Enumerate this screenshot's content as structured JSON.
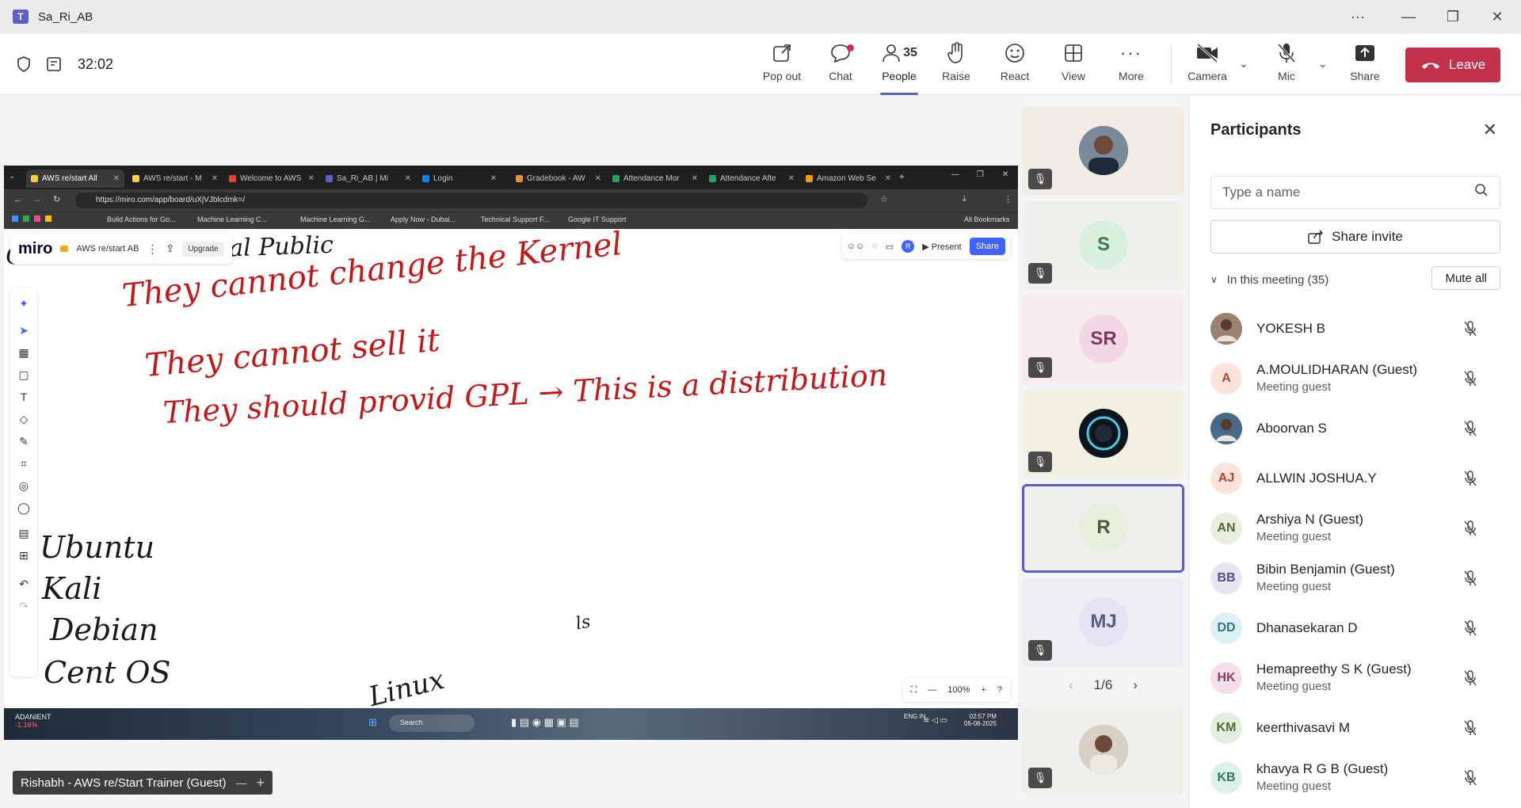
{
  "window": {
    "title": "Sa_Ri_AB",
    "controls": [
      "···",
      "—",
      "❐",
      "✕"
    ]
  },
  "toolbar": {
    "timer": "32:02",
    "buttons": [
      {
        "label": "Pop out",
        "icon": "pop-out-icon"
      },
      {
        "label": "Chat",
        "icon": "chat-icon"
      },
      {
        "label": "People",
        "icon": "people-icon",
        "count": "35"
      },
      {
        "label": "Raise",
        "icon": "raise-hand-icon"
      },
      {
        "label": "React",
        "icon": "react-icon"
      },
      {
        "label": "View",
        "icon": "view-icon"
      },
      {
        "label": "More",
        "icon": "more-icon"
      },
      {
        "label": "Camera",
        "icon": "camera-off-icon"
      },
      {
        "label": "Mic",
        "icon": "mic-off-icon"
      },
      {
        "label": "Share",
        "icon": "share-icon"
      }
    ],
    "leave_label": "Leave",
    "leave_color": "#c4314b",
    "accent": "#5b5fc7"
  },
  "shared_screen": {
    "tabs": [
      "AWS re/start All",
      "AWS re/start - M",
      "Welcome to AWS",
      "Sa_Ri_AB | Mi",
      "Login",
      "Gradebook - AW",
      "Attendance Mor",
      "Attendance Afte",
      "Amazon Web Se"
    ],
    "url": "https://miro.com/app/board/uXjVJblcdmk=/",
    "bookmarks": [
      "Build Actions for Go...",
      "Machine Learning C...",
      "Machine Learning G...",
      "Apply Now - Dubai...",
      "Technical Support F...",
      "Google IT Support",
      "All Bookmarks"
    ],
    "miro": {
      "logo": "miro",
      "board_name": "AWS re/start AB",
      "upgrade": "Upgrade",
      "present": "Present",
      "share": "Share",
      "avatar_initial": "R",
      "zoom": "100%"
    },
    "handwriting": {
      "top_partial": "Os   not   Unix        General    Public",
      "line1": "They  cannot  change  the  Kernel",
      "line2": "They  cannot   sell   it",
      "line3": "They  should   provid   GPL → This  is  a  distribution",
      "list": [
        "Ubuntu",
        "Kali",
        "Debian",
        "Cent OS"
      ],
      "bottom_partial": "Linux",
      "scribble": "ls"
    },
    "taskbar": {
      "stock": "ADANIENT",
      "stock_change": "-1.16%",
      "search": "Search",
      "lang": "ENG\nIN",
      "time": "02:57 PM",
      "date": "06-08-2025"
    }
  },
  "presenter_label": "Rishabh - AWS re/Start Trainer (Guest)",
  "video_tiles": [
    {
      "initials": "",
      "avatar": "photo",
      "color": "#3a4a5a"
    },
    {
      "initials": "S",
      "color": "#d9f0dc"
    },
    {
      "initials": "SR",
      "color": "#f3d9e6"
    },
    {
      "initials": "",
      "avatar": "logo",
      "color": "#101820"
    },
    {
      "initials": "R",
      "color": "#e6efdc"
    },
    {
      "initials": "MJ",
      "color": "#e6e3f3"
    },
    {
      "initials": "",
      "avatar": "photo",
      "color": "#8a7a6a"
    }
  ],
  "pager": "1/6",
  "participants_panel": {
    "title": "Participants",
    "search_placeholder": "Type a name",
    "share_invite": "Share invite",
    "in_meeting": "In this meeting (35)",
    "mute_all": "Mute all",
    "people": [
      {
        "name": "YOKESH B",
        "sub": "",
        "initials": "",
        "photo": true,
        "bg": "#9a8270",
        "fg": "#ffffff"
      },
      {
        "name": "A.MOULIDHARAN (Guest)",
        "sub": "Meeting guest",
        "initials": "A",
        "bg": "#fbe3dc",
        "fg": "#b04632"
      },
      {
        "name": "Aboorvan S",
        "sub": "",
        "initials": "",
        "photo": true,
        "bg": "#4a6a8a",
        "fg": "#ffffff"
      },
      {
        "name": "ALLWIN JOSHUA.Y",
        "sub": "",
        "initials": "AJ",
        "bg": "#fbe3dc",
        "fg": "#b04632"
      },
      {
        "name": "Arshiya N (Guest)",
        "sub": "Meeting guest",
        "initials": "AN",
        "bg": "#e8efde",
        "fg": "#4e6b32"
      },
      {
        "name": "Bibin Benjamin (Guest)",
        "sub": "Meeting guest",
        "initials": "BB",
        "bg": "#e6e6f3",
        "fg": "#4f4f8f"
      },
      {
        "name": "Dhanasekaran D",
        "sub": "",
        "initials": "DD",
        "bg": "#dcf1f4",
        "fg": "#2b7a85"
      },
      {
        "name": "Hemapreethy S K (Guest)",
        "sub": "Meeting guest",
        "initials": "HK",
        "bg": "#f3e0ea",
        "fg": "#8f3b62"
      },
      {
        "name": "keerthivasavi M",
        "sub": "",
        "initials": "KM",
        "bg": "#e3efde",
        "fg": "#4e6b32"
      },
      {
        "name": "khavya R G B (Guest)",
        "sub": "Meeting guest",
        "initials": "KB",
        "bg": "#dcf1ea",
        "fg": "#2b7a5a"
      }
    ]
  }
}
